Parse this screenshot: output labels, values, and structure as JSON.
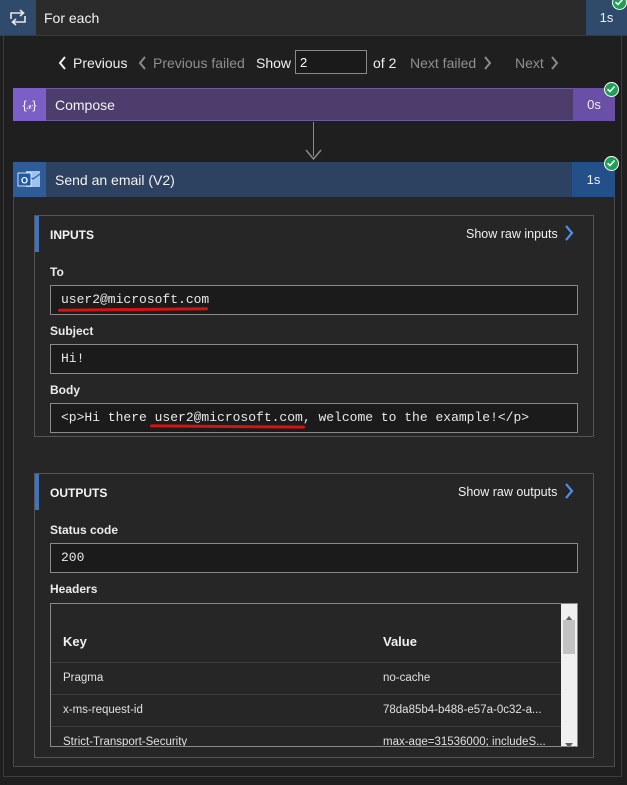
{
  "loop": {
    "title": "For each",
    "duration": "1s",
    "icon": "loop-icon",
    "status": "succeeded"
  },
  "pager": {
    "previous_label": "Previous",
    "previous_failed_label": "Previous failed",
    "show_label": "Show",
    "current_value": "2",
    "of_label": "of 2",
    "next_failed_label": "Next failed",
    "next_label": "Next"
  },
  "compose": {
    "title": "Compose",
    "duration": "0s",
    "icon": "compose-icon",
    "status": "succeeded"
  },
  "email": {
    "title": "Send an email (V2)",
    "duration": "1s",
    "icon": "outlook-icon",
    "status": "succeeded"
  },
  "inputs": {
    "heading": "INPUTS",
    "raw_link": "Show raw inputs",
    "to_label": "To",
    "to_value": "user2@microsoft.com",
    "subject_label": "Subject",
    "subject_value": "Hi!",
    "body_label": "Body",
    "body_value": "<p>Hi there user2@microsoft.com, welcome to the example!</p>"
  },
  "outputs": {
    "heading": "OUTPUTS",
    "raw_link": "Show raw outputs",
    "status_label": "Status code",
    "status_value": "200",
    "headers_label": "Headers",
    "table": {
      "col_key": "Key",
      "col_value": "Value",
      "rows": [
        {
          "key": "Pragma",
          "value": "no-cache"
        },
        {
          "key": "x-ms-request-id",
          "value": "78da85b4-b488-e57a-0c32-a..."
        },
        {
          "key": "Strict-Transport-Security",
          "value": "max-age=31536000; includeS..."
        }
      ]
    }
  },
  "colors": {
    "loop_accent": "#2f4a6b",
    "compose_accent": "#7b5fc6",
    "email_accent": "#2f5c96",
    "success": "#1f9e55",
    "redact_underline": "#d41313"
  }
}
